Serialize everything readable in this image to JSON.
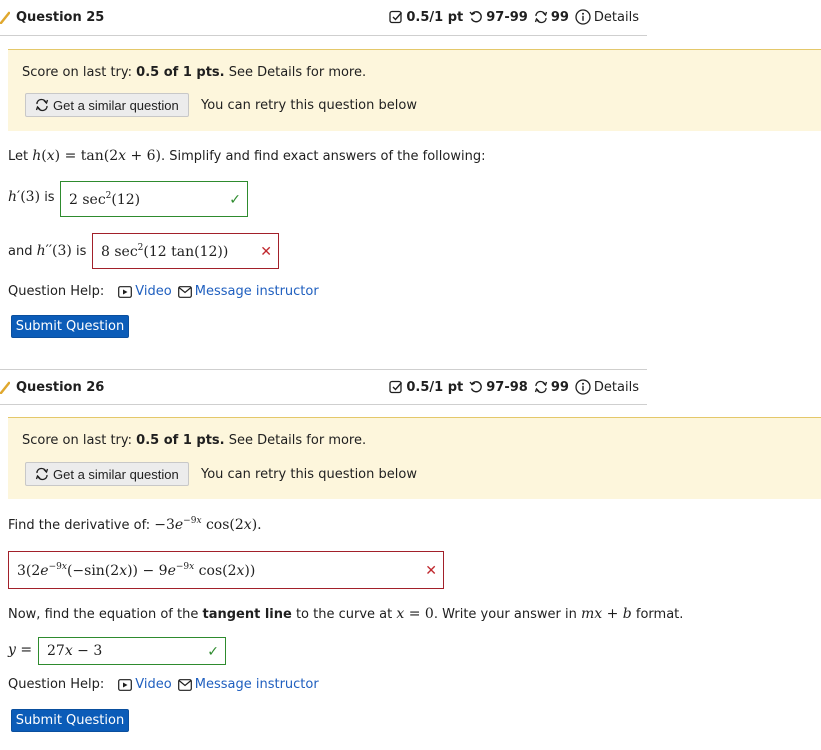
{
  "colors": {
    "correct": "#2e8b2e",
    "wrong": "#c0282e",
    "link": "#1f5fbf",
    "submit_bg": "#0b5cb8",
    "score_bg": "#fdf6dc"
  },
  "q25": {
    "title": "Question 25",
    "score": "0.5/1 pt",
    "attempts": "97-99",
    "retries": "99",
    "details": "Details",
    "score_prefix": "Score on last try: ",
    "score_value": "0.5 of 1 pts.",
    "score_suffix": " See Details for more.",
    "similar_label": "Get a similar question",
    "retry_text": "You can retry this question below",
    "prompt_prefix": "Let ",
    "prompt_func": "h(x) = tan(2x + 6)",
    "prompt_suffix": ". Simplify and find exact answers of the following:",
    "part1_label": "h′(3) is",
    "part1_answer": "2 sec²(12)",
    "part2_label": "and h′′(3) is",
    "part2_answer": "8 sec²(12 tan(12))",
    "help_label": "Question Help:",
    "video_label": "Video",
    "message_label": "Message instructor",
    "submit_label": "Submit Question"
  },
  "q26": {
    "title": "Question 26",
    "score": "0.5/1 pt",
    "attempts": "97-98",
    "retries": "99",
    "details": "Details",
    "score_prefix": "Score on last try: ",
    "score_value": "0.5 of 1 pts.",
    "score_suffix": " See Details for more.",
    "similar_label": "Get a similar question",
    "retry_text": "You can retry this question below",
    "prompt1_prefix": "Find the derivative of: ",
    "prompt1_func": "−3e^(−9x) cos(2x).",
    "answer1": "3(2e^(−9x)(−sin(2x)) − 9e^(−9x) cos(2x))",
    "prompt2_a": "Now, find the equation of the ",
    "prompt2_bold": "tangent line",
    "prompt2_b": " to the curve at ",
    "prompt2_math1": "x = 0",
    "prompt2_c": ". Write your answer in ",
    "prompt2_math2": "mx + b",
    "prompt2_d": " format.",
    "y_label": "y =",
    "answer2": "27x − 3",
    "help_label": "Question Help:",
    "video_label": "Video",
    "message_label": "Message instructor",
    "submit_label": "Submit Question"
  }
}
